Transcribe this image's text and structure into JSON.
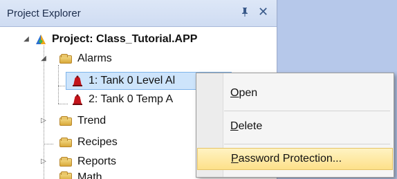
{
  "panel": {
    "title": "Project Explorer",
    "pin_glyph": "1",
    "close_glyph": "✕"
  },
  "tree": {
    "project_label": "Project: Class_Tutorial.APP",
    "alarms_label": "Alarms",
    "alarm_items": [
      "1: Tank 0 Level Al",
      "2: Tank 0 Temp A"
    ],
    "trend_label": "Trend",
    "recipes_label": "Recipes",
    "reports_label": "Reports",
    "math_label": "Math"
  },
  "context_menu": {
    "open": {
      "first": "O",
      "rest": "pen"
    },
    "delete": {
      "first": "D",
      "rest": "elete"
    },
    "password": {
      "first": "P",
      "rest": "assword Protection..."
    }
  },
  "colors": {
    "accent_blue": "#b6c8ea",
    "selection": "#cde4fb",
    "menu_highlight": "#fde08a"
  }
}
